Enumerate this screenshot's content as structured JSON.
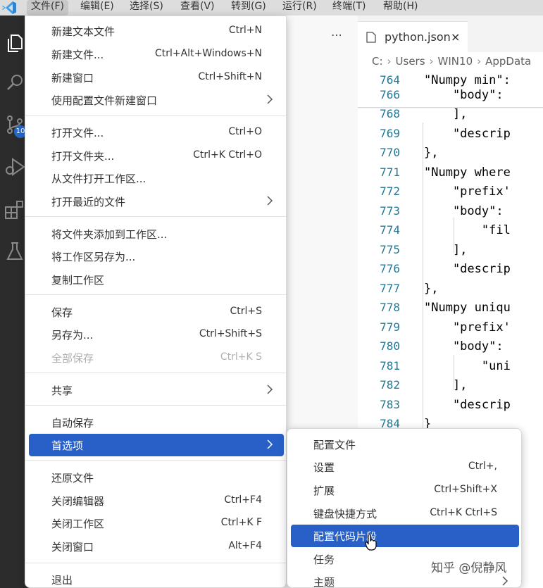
{
  "menubar": {
    "items": [
      "文件(F)",
      "编辑(E)",
      "选择(S)",
      "查看(V)",
      "转到(G)",
      "运行(R)",
      "终端(T)",
      "帮助(H)"
    ]
  },
  "activity": {
    "icons": [
      "explorer-icon",
      "search-icon",
      "source-control-icon",
      "run-debug-icon",
      "extensions-icon",
      "testing-icon"
    ],
    "scm_badge": "10"
  },
  "editor": {
    "tab_label": "python.json",
    "tab_close": "×",
    "breadcrumb": [
      "C:",
      "Users",
      "WIN10",
      "AppData"
    ],
    "lines": [
      {
        "num": "764",
        "text": "\"Numpy min\":"
      },
      {
        "num": "766",
        "text": "    \"body\":"
      },
      {
        "num": "768",
        "text": "    ],"
      },
      {
        "num": "769",
        "text": "    \"descrip"
      },
      {
        "num": "770",
        "text": "},"
      },
      {
        "num": "771",
        "text": "\"Numpy where"
      },
      {
        "num": "772",
        "text": "    \"prefix'"
      },
      {
        "num": "773",
        "text": "    \"body\":"
      },
      {
        "num": "774",
        "text": "        \"fil"
      },
      {
        "num": "775",
        "text": "    ],"
      },
      {
        "num": "776",
        "text": "    \"descrip"
      },
      {
        "num": "777",
        "text": "},"
      },
      {
        "num": "778",
        "text": "\"Numpy uniqu"
      },
      {
        "num": "779",
        "text": "    \"prefix'"
      },
      {
        "num": "780",
        "text": "    \"body\":"
      },
      {
        "num": "781",
        "text": "        \"uni"
      },
      {
        "num": "782",
        "text": "    ],"
      },
      {
        "num": "783",
        "text": "    \"descrip"
      },
      {
        "num": "784",
        "text": "}"
      }
    ]
  },
  "file_menu": {
    "groups": [
      [
        {
          "label": "新建文本文件",
          "kb": "Ctrl+N"
        },
        {
          "label": "新建文件...",
          "kb": "Ctrl+Alt+Windows+N"
        },
        {
          "label": "新建窗口",
          "kb": "Ctrl+Shift+N"
        },
        {
          "label": "使用配置文件新建窗口",
          "kb": "",
          "submenu": true
        }
      ],
      [
        {
          "label": "打开文件...",
          "kb": "Ctrl+O"
        },
        {
          "label": "打开文件夹...",
          "kb": "Ctrl+K Ctrl+O"
        },
        {
          "label": "从文件打开工作区...",
          "kb": ""
        },
        {
          "label": "打开最近的文件",
          "kb": "",
          "submenu": true
        }
      ],
      [
        {
          "label": "将文件夹添加到工作区...",
          "kb": ""
        },
        {
          "label": "将工作区另存为...",
          "kb": ""
        },
        {
          "label": "复制工作区",
          "kb": ""
        }
      ],
      [
        {
          "label": "保存",
          "kb": "Ctrl+S"
        },
        {
          "label": "另存为...",
          "kb": "Ctrl+Shift+S"
        },
        {
          "label": "全部保存",
          "kb": "Ctrl+K S",
          "disabled": true
        }
      ],
      [
        {
          "label": "共享",
          "kb": "",
          "submenu": true
        }
      ],
      [
        {
          "label": "自动保存",
          "kb": ""
        },
        {
          "label": "首选项",
          "kb": "",
          "submenu": true,
          "selected": true
        }
      ],
      [
        {
          "label": "还原文件",
          "kb": ""
        },
        {
          "label": "关闭编辑器",
          "kb": "Ctrl+F4"
        },
        {
          "label": "关闭工作区",
          "kb": "Ctrl+K F"
        },
        {
          "label": "关闭窗口",
          "kb": "Alt+F4"
        }
      ],
      [
        {
          "label": "退出",
          "kb": ""
        }
      ]
    ]
  },
  "preferences_menu": {
    "items": [
      {
        "label": "配置文件",
        "kb": ""
      },
      {
        "label": "设置",
        "kb": "Ctrl+,"
      },
      {
        "label": "扩展",
        "kb": "Ctrl+Shift+X"
      },
      {
        "label": "键盘快捷方式",
        "kb": "Ctrl+K Ctrl+S"
      },
      {
        "label": "配置代码片段",
        "kb": "",
        "selected": true
      },
      {
        "label": "任务",
        "kb": ""
      },
      {
        "label": "主题",
        "kb": "",
        "submenu": true
      }
    ]
  },
  "watermark": "知乎 @倪静风",
  "colors": {
    "accent": "#2860c8",
    "activity_bar": "#2c2c2c",
    "menubar": "#dddddd",
    "line_number": "#237893",
    "json_key": "#0451a5"
  }
}
